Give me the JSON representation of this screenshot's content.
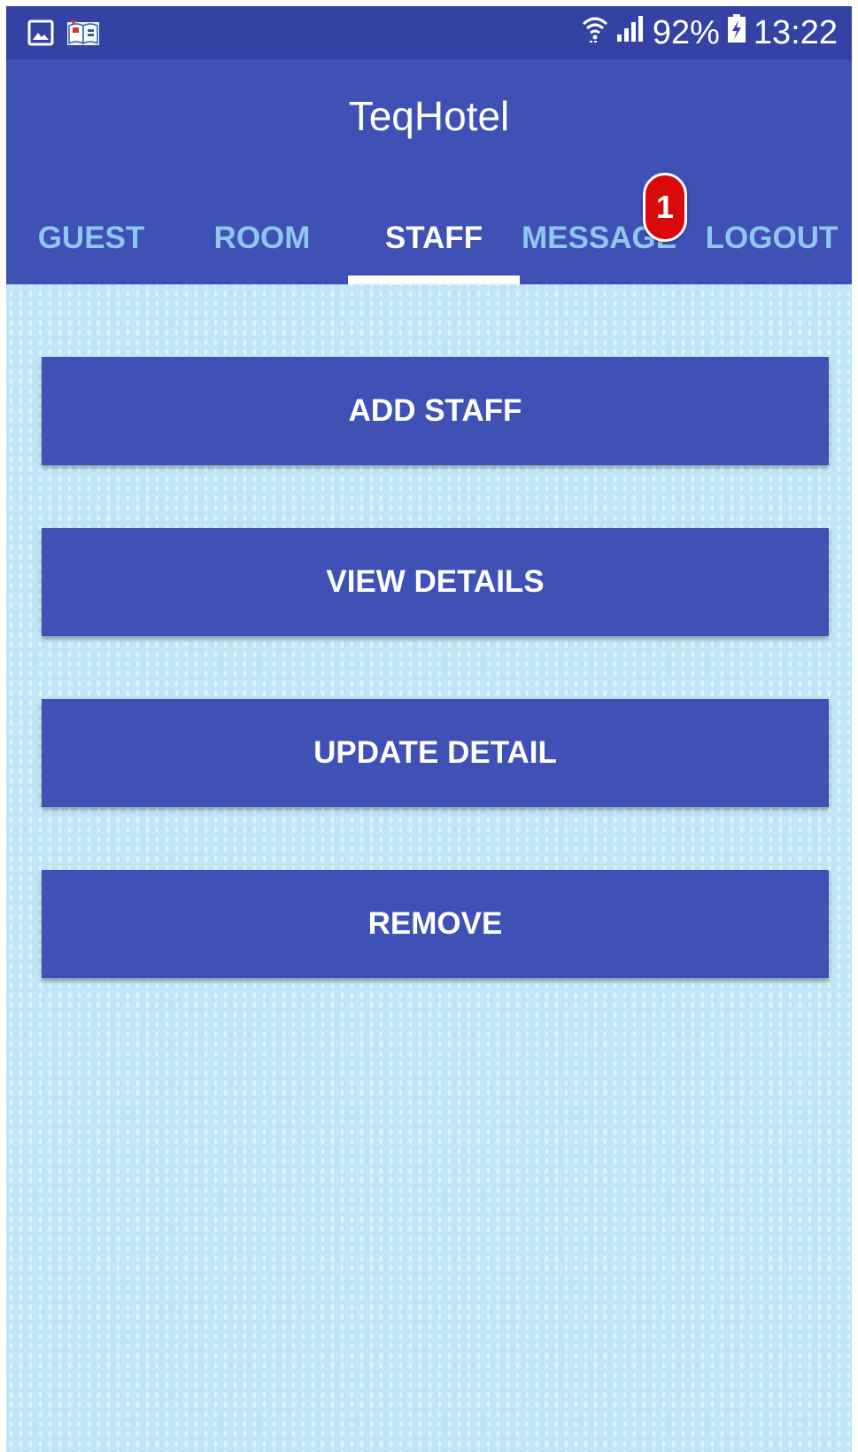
{
  "status_bar": {
    "icons_left": [
      "gallery-icon",
      "book-app-icon"
    ],
    "icons_right": [
      "wifi-icon",
      "signal-icon",
      "battery-charging-icon"
    ],
    "battery": "92%",
    "time": "13:22"
  },
  "app": {
    "title": "TeqHotel"
  },
  "tabs": [
    {
      "label": "GUEST",
      "active": false
    },
    {
      "label": "ROOM",
      "active": false
    },
    {
      "label": "STAFF",
      "active": true
    },
    {
      "label": "MESSAGE",
      "active": false
    },
    {
      "label": "LOGOUT",
      "active": false
    }
  ],
  "badge": {
    "count": "1"
  },
  "actions": [
    {
      "label": "ADD STAFF"
    },
    {
      "label": "VIEW DETAILS"
    },
    {
      "label": "UPDATE DETAIL"
    },
    {
      "label": "REMOVE"
    }
  ],
  "colors": {
    "primary": "#3f51b5",
    "status_bar": "#3443a3",
    "tab_inactive": "#8cc8f0",
    "badge": "#d90a0a",
    "background": "#bfe6f7"
  }
}
